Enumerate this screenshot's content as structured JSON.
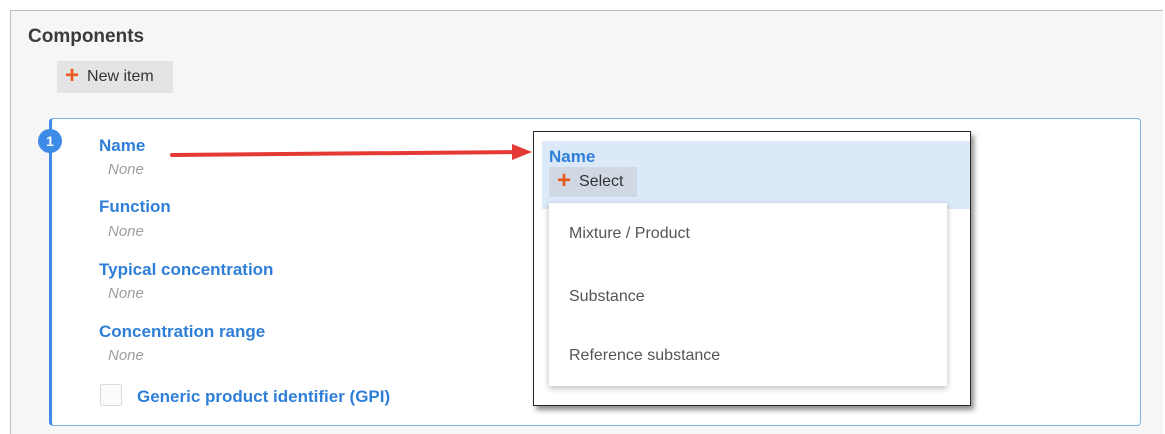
{
  "section": {
    "title": "Components"
  },
  "toolbar": {
    "new_item_label": "New item"
  },
  "item": {
    "index": "1",
    "fields": [
      {
        "label": "Name",
        "value": "None"
      },
      {
        "label": "Function",
        "value": "None"
      },
      {
        "label": "Typical concentration",
        "value": "None"
      },
      {
        "label": "Concentration range",
        "value": "None"
      }
    ],
    "gpi_label": "Generic product identifier (GPI)"
  },
  "callout": {
    "field_label": "Name",
    "select_label": "Select",
    "options": [
      "Mixture / Product",
      "Substance",
      "Reference substance"
    ]
  },
  "colors": {
    "accent": "#3d8be6",
    "label_blue": "#2f7fd8",
    "plus_orange": "#e9581e",
    "arrow_red": "#e53935"
  },
  "icons": [
    "plus-icon",
    "trash-icon",
    "arrow-annotation"
  ]
}
